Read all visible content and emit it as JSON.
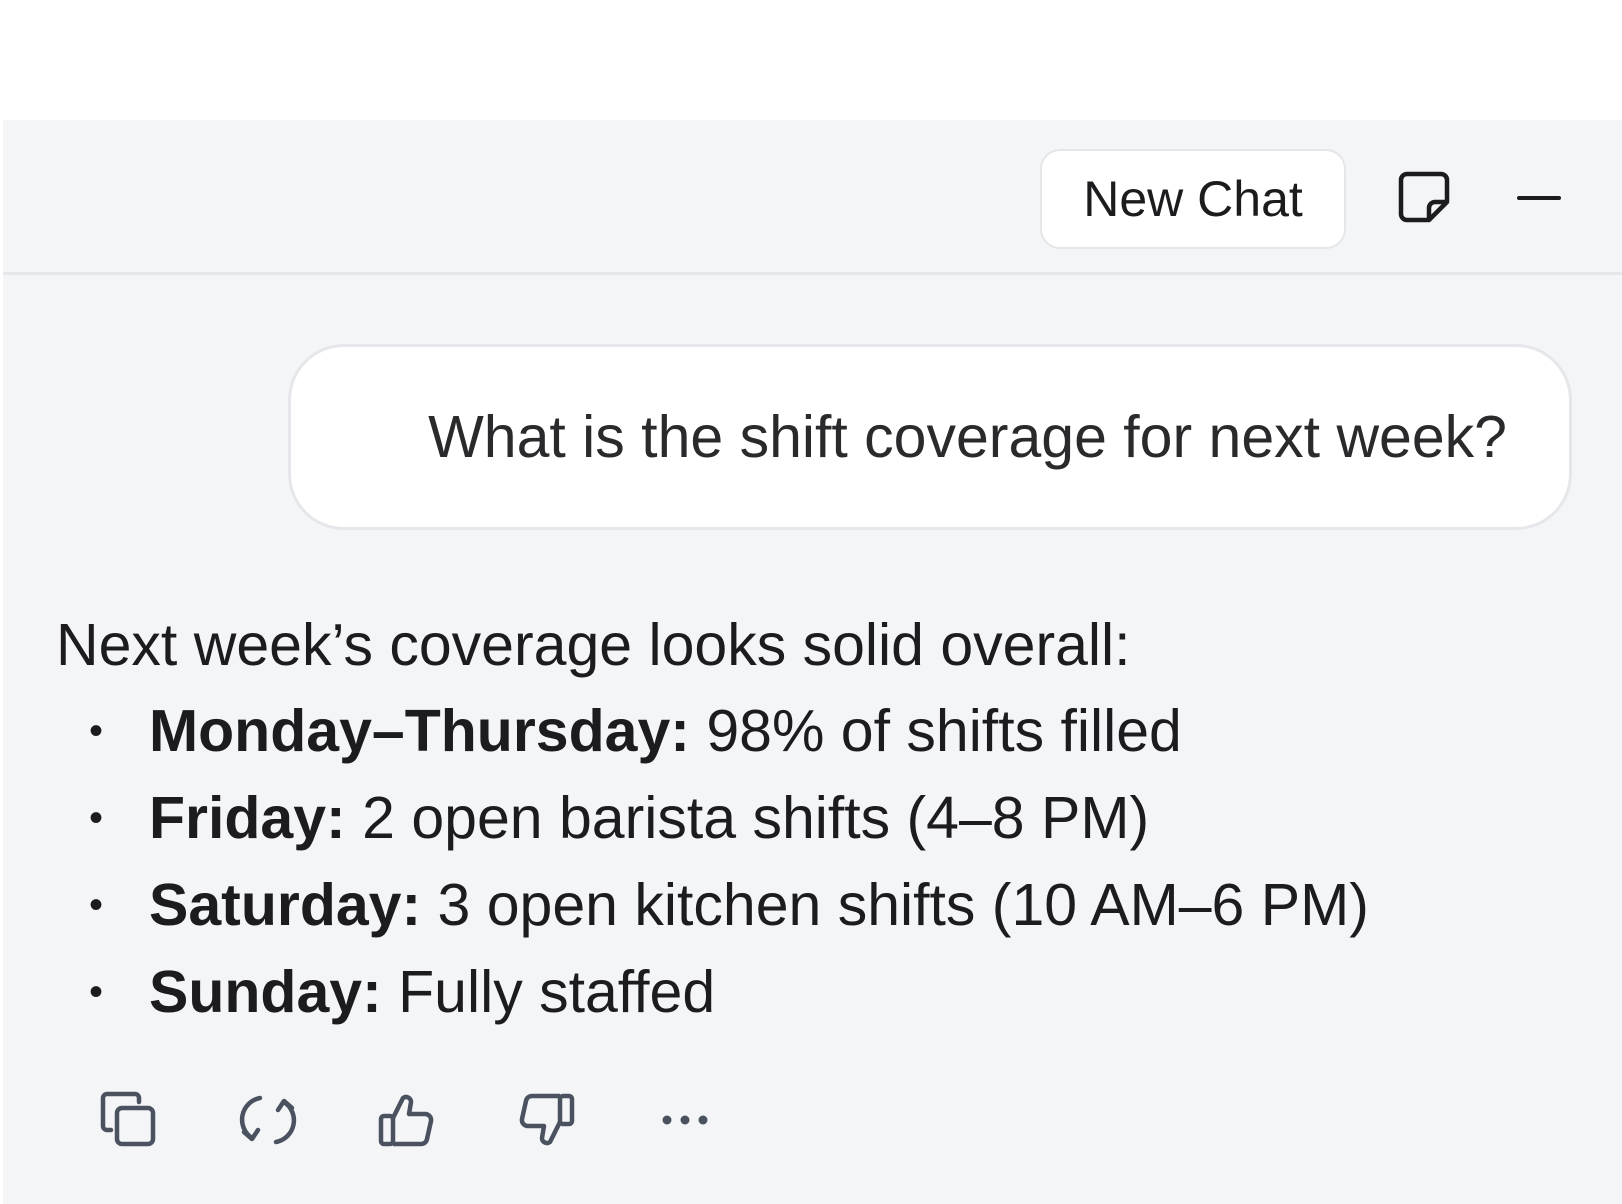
{
  "header": {
    "new_chat_label": "New Chat",
    "icons": [
      "note-icon",
      "minimize-icon"
    ]
  },
  "conversation": {
    "user_message": "What is the shift coverage for next week?",
    "assistant": {
      "intro": "Next week’s coverage looks solid overall:",
      "items": [
        {
          "label": "Monday–Thursday:",
          "text": " 98% of shifts filled"
        },
        {
          "label": "Friday:",
          "text": " 2 open barista shifts (4–8 PM)"
        },
        {
          "label": "Saturday:",
          "text": " 3 open kitchen shifts (10 AM–6 PM)"
        },
        {
          "label": "Sunday:",
          "text": " Fully staffed"
        }
      ],
      "bullet": "•"
    }
  },
  "actions": [
    "copy-icon",
    "regenerate-icon",
    "thumbs-up-icon",
    "thumbs-down-icon",
    "more-icon"
  ],
  "colors": {
    "panel_bg": "#f4f5f7",
    "border": "#e6e7ea",
    "icon": "#4a5260",
    "text": "#1c1c1f"
  }
}
